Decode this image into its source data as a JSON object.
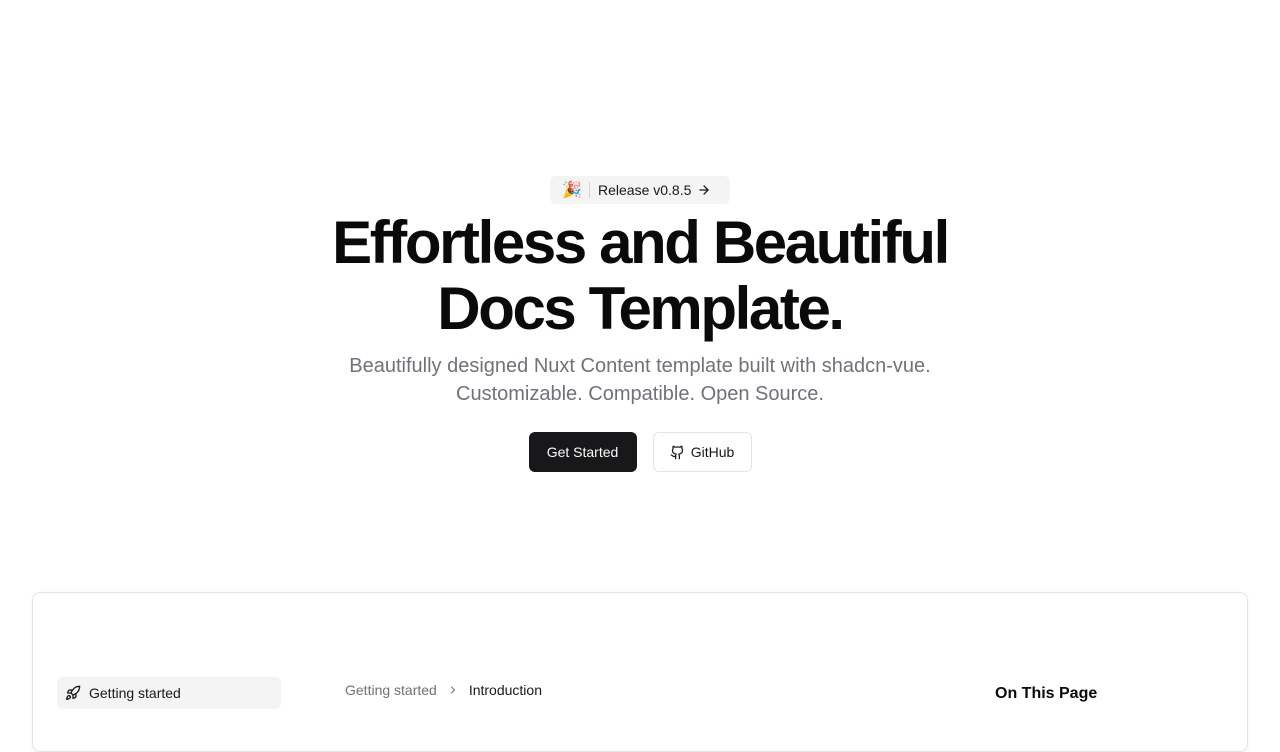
{
  "hero": {
    "badge": {
      "emoji": "🎉",
      "label": "Release v0.8.5"
    },
    "title_line1": "Effortless and Beautiful",
    "title_line2": "Docs Template.",
    "subtitle_line1": "Beautifully designed Nuxt Content template built with shadcn-vue.",
    "subtitle_line2": "Customizable. Compatible. Open Source.",
    "get_started_label": "Get Started",
    "github_label": "GitHub"
  },
  "preview": {
    "sidebar": {
      "items": [
        {
          "label": "Getting started",
          "icon": "rocket-icon"
        }
      ]
    },
    "breadcrumb": {
      "parent": "Getting started",
      "current": "Introduction"
    },
    "toc": {
      "title": "On This Page"
    }
  },
  "colors": {
    "primary": "#18181b",
    "muted_text": "#71717a",
    "border": "#e4e4e7",
    "badge_bg": "#f4f4f5"
  }
}
